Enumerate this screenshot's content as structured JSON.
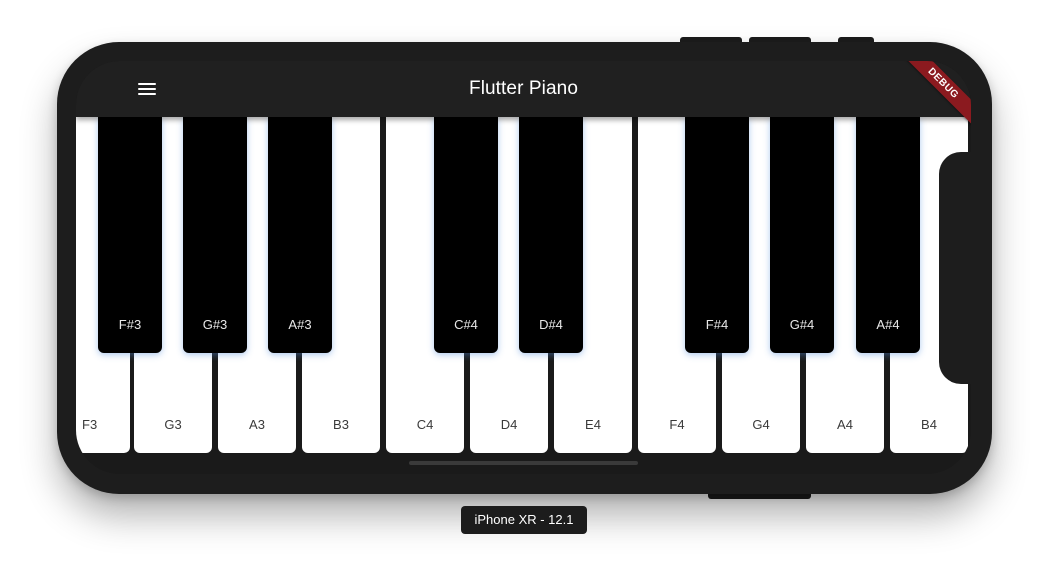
{
  "app": {
    "title": "Flutter Piano",
    "banner": "DEBUG",
    "menu_icon": "hamburger-menu-icon"
  },
  "simulator": {
    "device_label": "iPhone XR - 12.1"
  },
  "keyboard": {
    "white_keys": [
      "F3",
      "G3",
      "A3",
      "B3",
      "C4",
      "D4",
      "E4",
      "F4",
      "G4",
      "A4",
      "B4"
    ],
    "black_keys": [
      "F#3",
      "G#3",
      "A#3",
      "C#4",
      "D#4",
      "F#4",
      "G#4",
      "A#4"
    ]
  },
  "colors": {
    "app_bar": "#202020",
    "banner": "#8b1a1f",
    "white_key": "#ffffff",
    "black_key": "#000000",
    "device_frame": "#1d1d1d"
  }
}
